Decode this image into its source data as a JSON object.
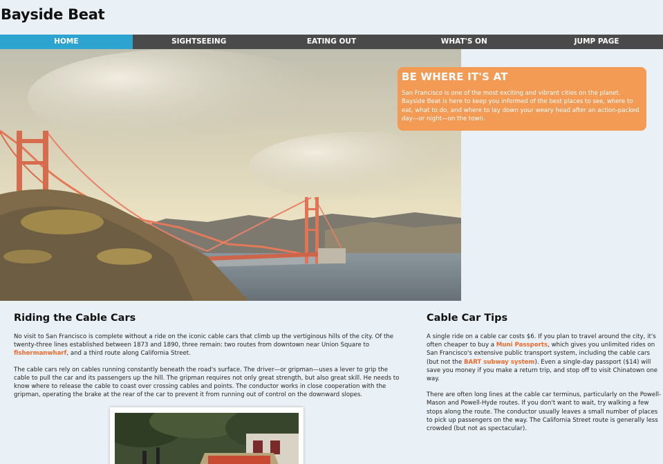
{
  "site": {
    "title": "Bayside Beat"
  },
  "nav": {
    "items": [
      {
        "label": "HOME",
        "active": true
      },
      {
        "label": "SIGHTSEEING",
        "active": false
      },
      {
        "label": "EATING OUT",
        "active": false
      },
      {
        "label": "WHAT'S ON",
        "active": false
      },
      {
        "label": "JUMP PAGE",
        "active": false
      }
    ]
  },
  "hero": {
    "image": "golden-gate-bridge-photo"
  },
  "callout": {
    "title": "BE WHERE IT'S AT",
    "body": "San Francisco is one of the most exciting and vibrant cities on the planet. Bayside Beat is here to keep you informed of the best places to see, where to eat, what to do, and where to lay down your weary head after an action-packed day—or night—on the town."
  },
  "article": {
    "heading": "Riding the Cable Cars",
    "p1_a": "No visit to San Francisco is complete without a ride on the iconic cable cars that climb up the vertiginous hills of the city. Of the twenty-three lines established between 1873 and 1890, three remain: two routes from downtown near Union Square to ",
    "p1_link": "fishermanwharf",
    "p1_b": ", and a third route along California Street.",
    "p2": "The cable cars rely on cables running constantly beneath the road's surface. The driver—or gripman—uses a lever to grip the cable to pull the car and its passengers up the hill. The gripman requires not only great strength, but also great skill. He needs to know where to release the cable to coast over crossing cables and points. The conductor works in close cooperation with the gripman, operating the brake at the rear of the car to prevent it from running out of control on the downward slopes.",
    "photo": "cable-car-photo"
  },
  "tips": {
    "heading": "Cable Car Tips",
    "p1_a": "A single ride on a cable car costs $6. If you plan to travel around the city, it's often cheaper to buy a ",
    "p1_link1": "Muni Passports",
    "p1_b": ", which gives you unlimited rides on San Francisco's extensive public transport system, including the cable cars (but not the ",
    "p1_link2": "BART subway system",
    "p1_c": "). Even a single-day passport ($14) will save you money if you make a return trip, and stop off to visit Chinatown one way.",
    "p2": "There are often long lines at the cable car terminus, particularly on the Powell-Mason and Powell-Hyde routes. If you don't want to wait, try walking a few stops along the route. The conductor usually leaves a small number of places to pick up passengers on the way. The California Street route is generally less crowded (but not as spectacular)."
  },
  "colors": {
    "nav_bg": "#4a4a4a",
    "nav_active": "#2da3cf",
    "callout_bg": "#f39a55",
    "link": "#ef6a2b",
    "page_bg": "#eaf1f6"
  }
}
